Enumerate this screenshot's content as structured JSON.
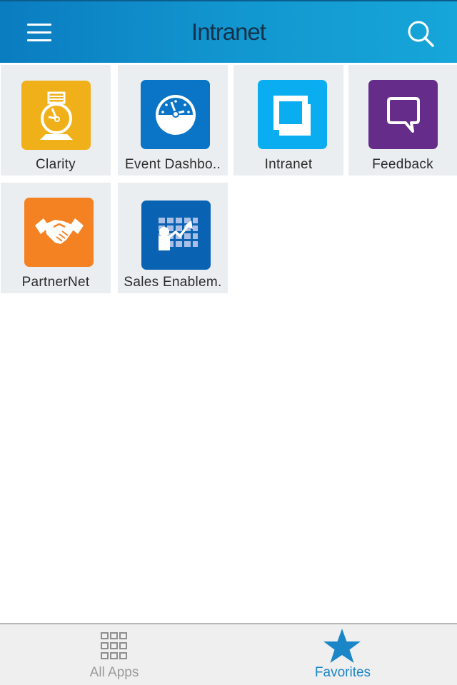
{
  "header": {
    "title": "Intranet",
    "menu_icon": "hamburger-menu-icon",
    "search_icon": "search-icon"
  },
  "apps": [
    {
      "label": "Clarity",
      "icon": "desk-clock-icon",
      "color": "#f0b01a"
    },
    {
      "label": "Event Dashbo..",
      "icon": "speedometer-gauge-icon",
      "color": "#0a74c6"
    },
    {
      "label": "Intranet",
      "icon": "overlapping-squares-icon",
      "color": "#0aaef0"
    },
    {
      "label": "Feedback",
      "icon": "speech-bubble-icon",
      "color": "#652c8a"
    },
    {
      "label": "PartnerNet",
      "icon": "handshake-icon",
      "color": "#f58222"
    },
    {
      "label": "Sales Enablem.",
      "icon": "chart-presenter-icon",
      "color": "#0a62b2"
    }
  ],
  "tabbar": {
    "tabs": [
      {
        "label": "All Apps",
        "icon": "grid-icon",
        "active": false
      },
      {
        "label": "Favorites",
        "icon": "star-icon",
        "active": true
      }
    ],
    "active_color": "#1a86c8",
    "inactive_color": "#9a9a9a"
  }
}
